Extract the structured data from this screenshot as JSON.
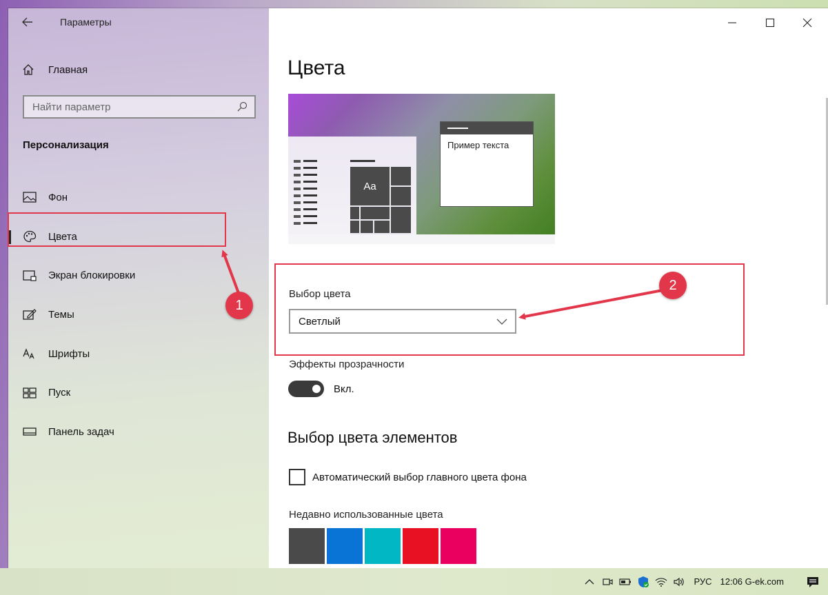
{
  "window": {
    "app_title": "Параметры",
    "controls": {
      "minimize": "minimize-icon",
      "maximize": "maximize-icon",
      "close": "close-icon"
    }
  },
  "sidebar": {
    "home_label": "Главная",
    "search_placeholder": "Найти параметр",
    "section_title": "Персонализация",
    "items": [
      {
        "label": "Фон",
        "icon": "image-icon"
      },
      {
        "label": "Цвета",
        "icon": "palette-icon",
        "active": true
      },
      {
        "label": "Экран блокировки",
        "icon": "lock-screen-icon"
      },
      {
        "label": "Темы",
        "icon": "themes-icon"
      },
      {
        "label": "Шрифты",
        "icon": "fonts-icon"
      },
      {
        "label": "Пуск",
        "icon": "start-icon"
      },
      {
        "label": "Панель задач",
        "icon": "taskbar-icon"
      }
    ]
  },
  "main": {
    "title": "Цвета",
    "preview": {
      "tile_text": "Aa",
      "window_text": "Пример текста"
    },
    "color_choice_label": "Выбор цвета",
    "color_choice_value": "Светлый",
    "transparency_label": "Эффекты прозрачности",
    "transparency_state": "Вкл.",
    "transparency_on": true,
    "accent_heading": "Выбор цвета элементов",
    "auto_accent_label": "Автоматический выбор главного цвета фона",
    "auto_accent_checked": false,
    "recent_colors_label": "Недавно использованные цвета",
    "recent_colors": [
      "#4a4a4a",
      "#0a74d6",
      "#00b7c3",
      "#e81123",
      "#ea005e"
    ]
  },
  "annotations": {
    "badge1": "1",
    "badge2": "2",
    "color": "#e2374a"
  },
  "taskbar": {
    "language": "РУС",
    "clock": "12:06 G-ek.com",
    "icons": [
      "chevron-up-icon",
      "meet-now-icon",
      "battery-icon",
      "defender-icon",
      "wifi-icon",
      "volume-icon",
      "notification-icon"
    ]
  }
}
